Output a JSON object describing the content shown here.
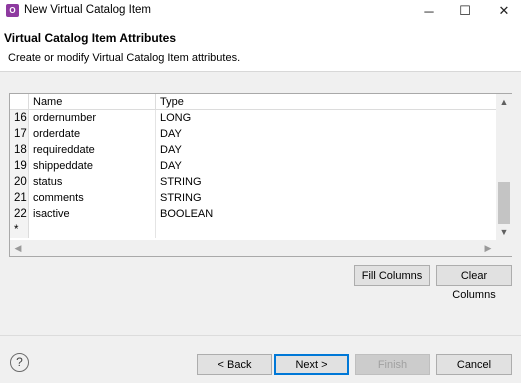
{
  "window": {
    "title": "New Virtual Catalog Item",
    "icon": "app-icon",
    "controls": {
      "minimize": "─",
      "maximize": "☐",
      "close": "✕"
    }
  },
  "header": {
    "title": "Virtual Catalog Item Attributes",
    "description": "Create or modify Virtual Catalog Item attributes."
  },
  "table": {
    "columns": [
      "Name",
      "Type"
    ],
    "rows": [
      {
        "num": "16",
        "name": "ordernumber",
        "type": "LONG"
      },
      {
        "num": "17",
        "name": "orderdate",
        "type": "DAY"
      },
      {
        "num": "18",
        "name": "requireddate",
        "type": "DAY"
      },
      {
        "num": "19",
        "name": "shippeddate",
        "type": "DAY"
      },
      {
        "num": "20",
        "name": "status",
        "type": "STRING"
      },
      {
        "num": "21",
        "name": "comments",
        "type": "STRING"
      },
      {
        "num": "22",
        "name": "isactive",
        "type": "BOOLEAN"
      },
      {
        "num": "*",
        "name": "",
        "type": ""
      }
    ]
  },
  "actions": {
    "fill_columns": "Fill Columns",
    "clear_columns": "Clear Columns"
  },
  "footer": {
    "help": "?",
    "back": "< Back",
    "next": "Next >",
    "finish": "Finish",
    "cancel": "Cancel"
  },
  "colors": {
    "accent": "#0078d7",
    "app_icon": "#8e3aa0"
  }
}
